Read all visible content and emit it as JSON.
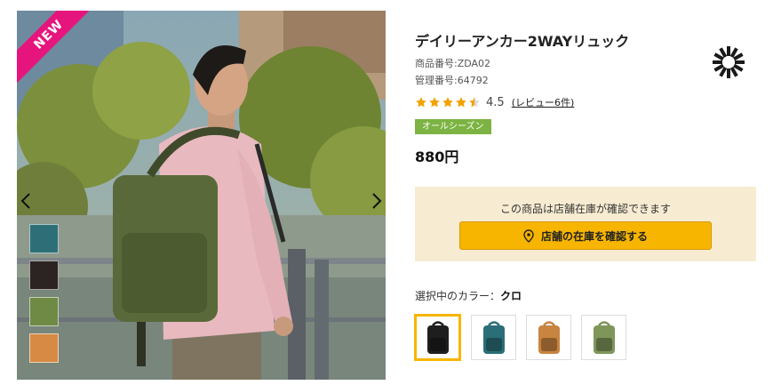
{
  "badge": "NEW",
  "gallery": {
    "swatches": [
      {
        "name": "teal",
        "color": "#2e6f77"
      },
      {
        "name": "black",
        "color": "#2b2422"
      },
      {
        "name": "olive",
        "color": "#6e8a45"
      },
      {
        "name": "tan",
        "color": "#d68a43"
      }
    ]
  },
  "product": {
    "title": "デイリーアンカー2WAYリュック",
    "code": "商品番号:ZDA02",
    "management_no": "管理番号:64792",
    "rating": 4.5,
    "rating_text": "4.5",
    "review_link": "(レビュー6件)",
    "season_tag": "オールシーズン",
    "price": "880円"
  },
  "stock": {
    "message": "この商品は店舗在庫が確認できます",
    "button_label": "店舗の在庫を確認する"
  },
  "color_select": {
    "label": "選択中のカラー：",
    "selected": "クロ",
    "options": [
      {
        "name": "black",
        "color": "#1e1e1e",
        "selected": true
      },
      {
        "name": "teal",
        "color": "#2a6e77",
        "selected": false
      },
      {
        "name": "camel",
        "color": "#c9843f",
        "selected": false
      },
      {
        "name": "olive",
        "color": "#7e965a",
        "selected": false
      }
    ]
  },
  "colors": {
    "accent": "#f7b500",
    "badge": "#e6157d",
    "season": "#7cb342",
    "star": "#f2a200",
    "stock_bg": "#f7ecd2"
  }
}
